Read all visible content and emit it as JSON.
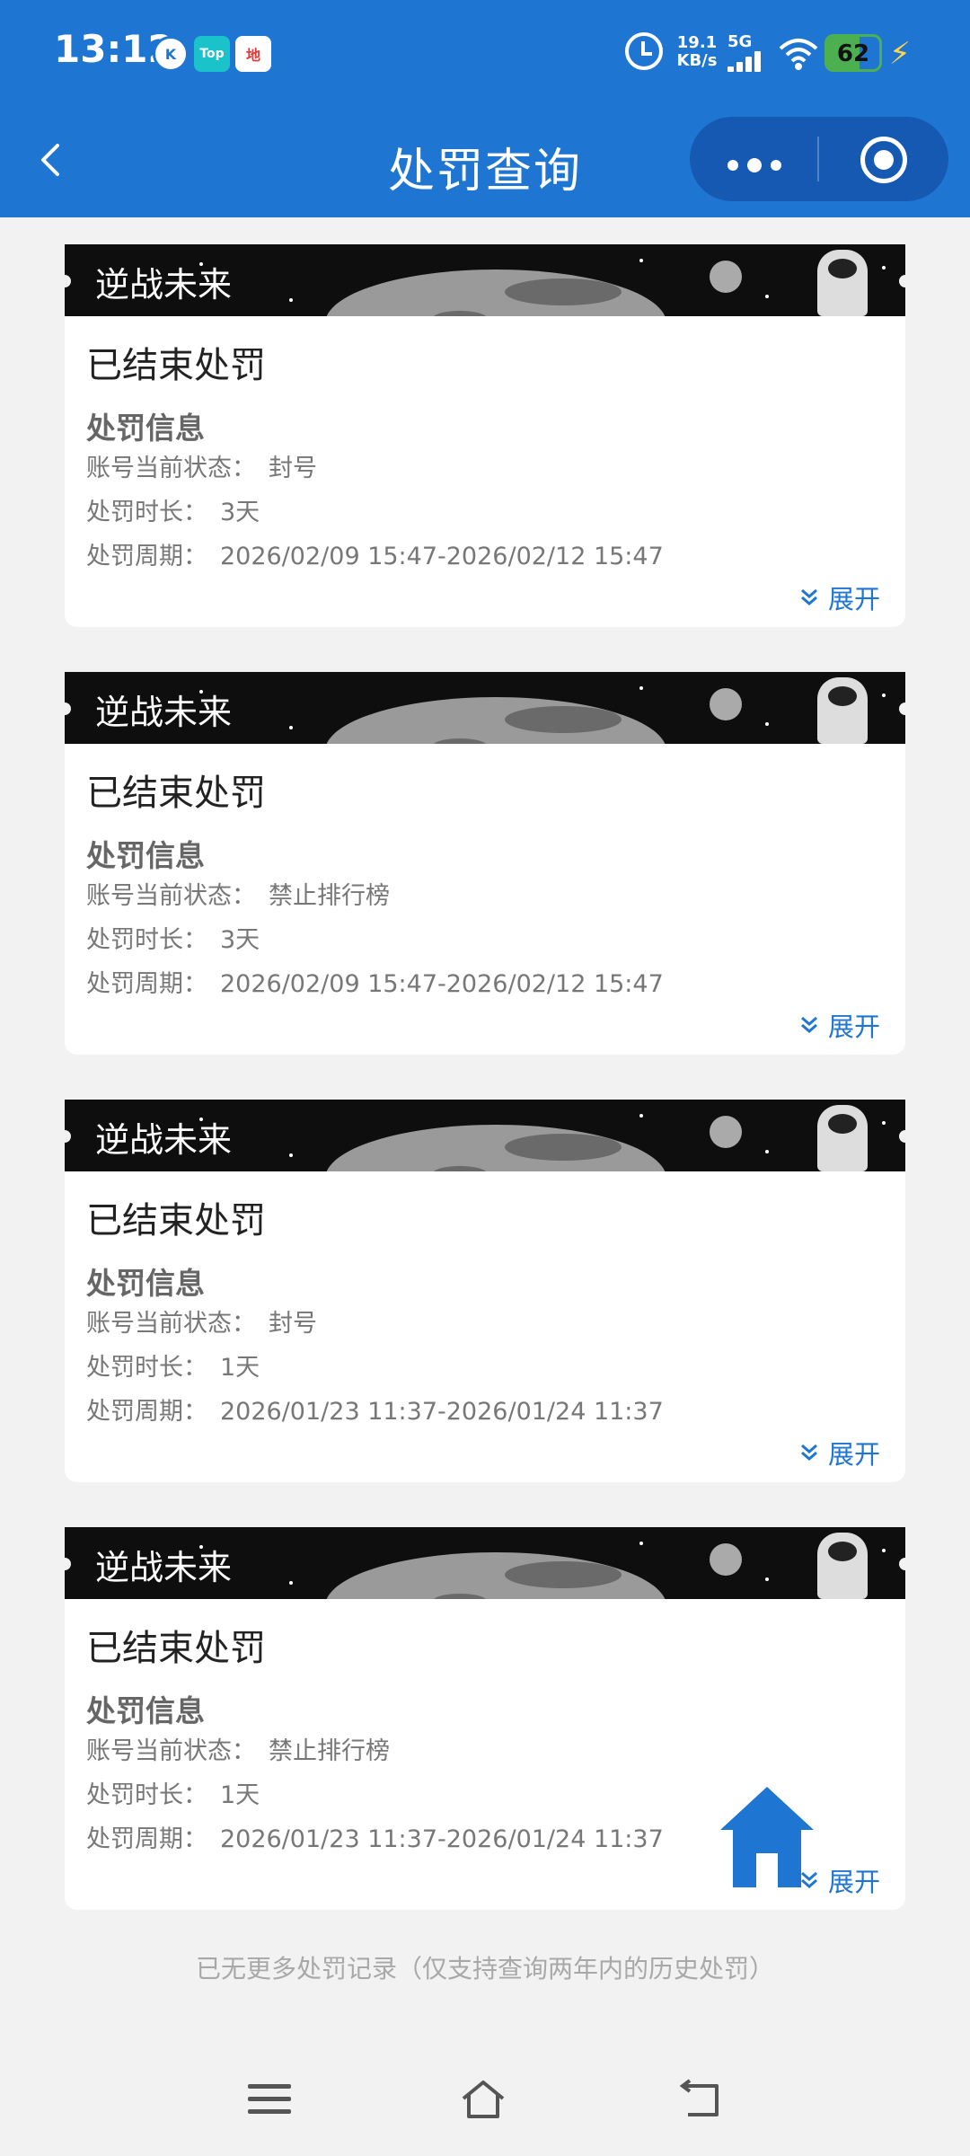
{
  "status_bar": {
    "time": "13:12",
    "app_icons": [
      "k-icon",
      "top-icon",
      "map-icon"
    ],
    "app_icon_texts": [
      "K",
      "Top",
      "地"
    ],
    "net_speed_value": "19.1",
    "net_speed_unit": "KB/s",
    "network": "5G",
    "battery": "62",
    "battery_level": 0.62
  },
  "header": {
    "title": "处罚查询",
    "accent_color": "#1f76d2"
  },
  "cards": [
    {
      "banner_text": "逆战未来",
      "status_title": "已结束处罚",
      "section_title": "处罚信息",
      "state_label": "账号当前状态：",
      "state_value": "封号",
      "duration_label": "处罚时长：",
      "duration_value": "3天",
      "period_label": "处罚周期：",
      "period_value": "2026/02/09 15:47-2026/02/12 15:47",
      "expand_label": "展开"
    },
    {
      "banner_text": "逆战未来",
      "status_title": "已结束处罚",
      "section_title": "处罚信息",
      "state_label": "账号当前状态：",
      "state_value": "禁止排行榜",
      "duration_label": "处罚时长：",
      "duration_value": "3天",
      "period_label": "处罚周期：",
      "period_value": "2026/02/09 15:47-2026/02/12 15:47",
      "expand_label": "展开"
    },
    {
      "banner_text": "逆战未来",
      "status_title": "已结束处罚",
      "section_title": "处罚信息",
      "state_label": "账号当前状态：",
      "state_value": "封号",
      "duration_label": "处罚时长：",
      "duration_value": "1天",
      "period_label": "处罚周期：",
      "period_value": "2026/01/23 11:37-2026/01/24 11:37",
      "expand_label": "展开"
    },
    {
      "banner_text": "逆战未来",
      "status_title": "已结束处罚",
      "section_title": "处罚信息",
      "state_label": "账号当前状态：",
      "state_value": "禁止排行榜",
      "duration_label": "处罚时长：",
      "duration_value": "1天",
      "period_label": "处罚周期：",
      "period_value": "2026/01/23 11:37-2026/01/24 11:37",
      "expand_label": "展开"
    }
  ],
  "footnote": "已无更多处罚记录（仅支持查询两年内的历史处罚）",
  "fab_icon": "home-icon",
  "nav_icons": [
    "menu-icon",
    "home-icon",
    "back-icon"
  ]
}
